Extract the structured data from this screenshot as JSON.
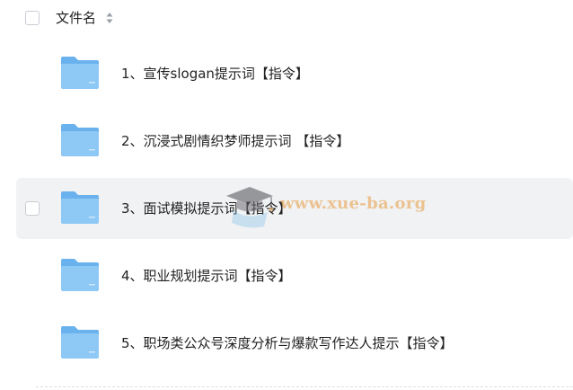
{
  "header": {
    "title": "文件名",
    "sort_icon": "sort-caret-icon"
  },
  "rows": [
    {
      "label": "1、宣传slogan提示词【指令】",
      "icon": "folder-icon"
    },
    {
      "label": "2、沉浸式剧情织梦师提示词 【指令】",
      "icon": "folder-icon"
    },
    {
      "label": "3、面试模拟提示词【指令】",
      "icon": "folder-icon",
      "hovered": true
    },
    {
      "label": "4、职业规划提示词【指令】",
      "icon": "folder-icon"
    },
    {
      "label": "5、职场类公众号深度分析与爆款写作达人提示【指令】",
      "icon": "folder-icon"
    }
  ],
  "watermark": {
    "text": "www.xue-ba.org",
    "icon": "graduation-cap-icon"
  },
  "colors": {
    "folder_light": "#8ec8f5",
    "folder_dark": "#6ab2ee",
    "hover_row": "#f1f2f4",
    "watermark": "#e8a85a"
  }
}
